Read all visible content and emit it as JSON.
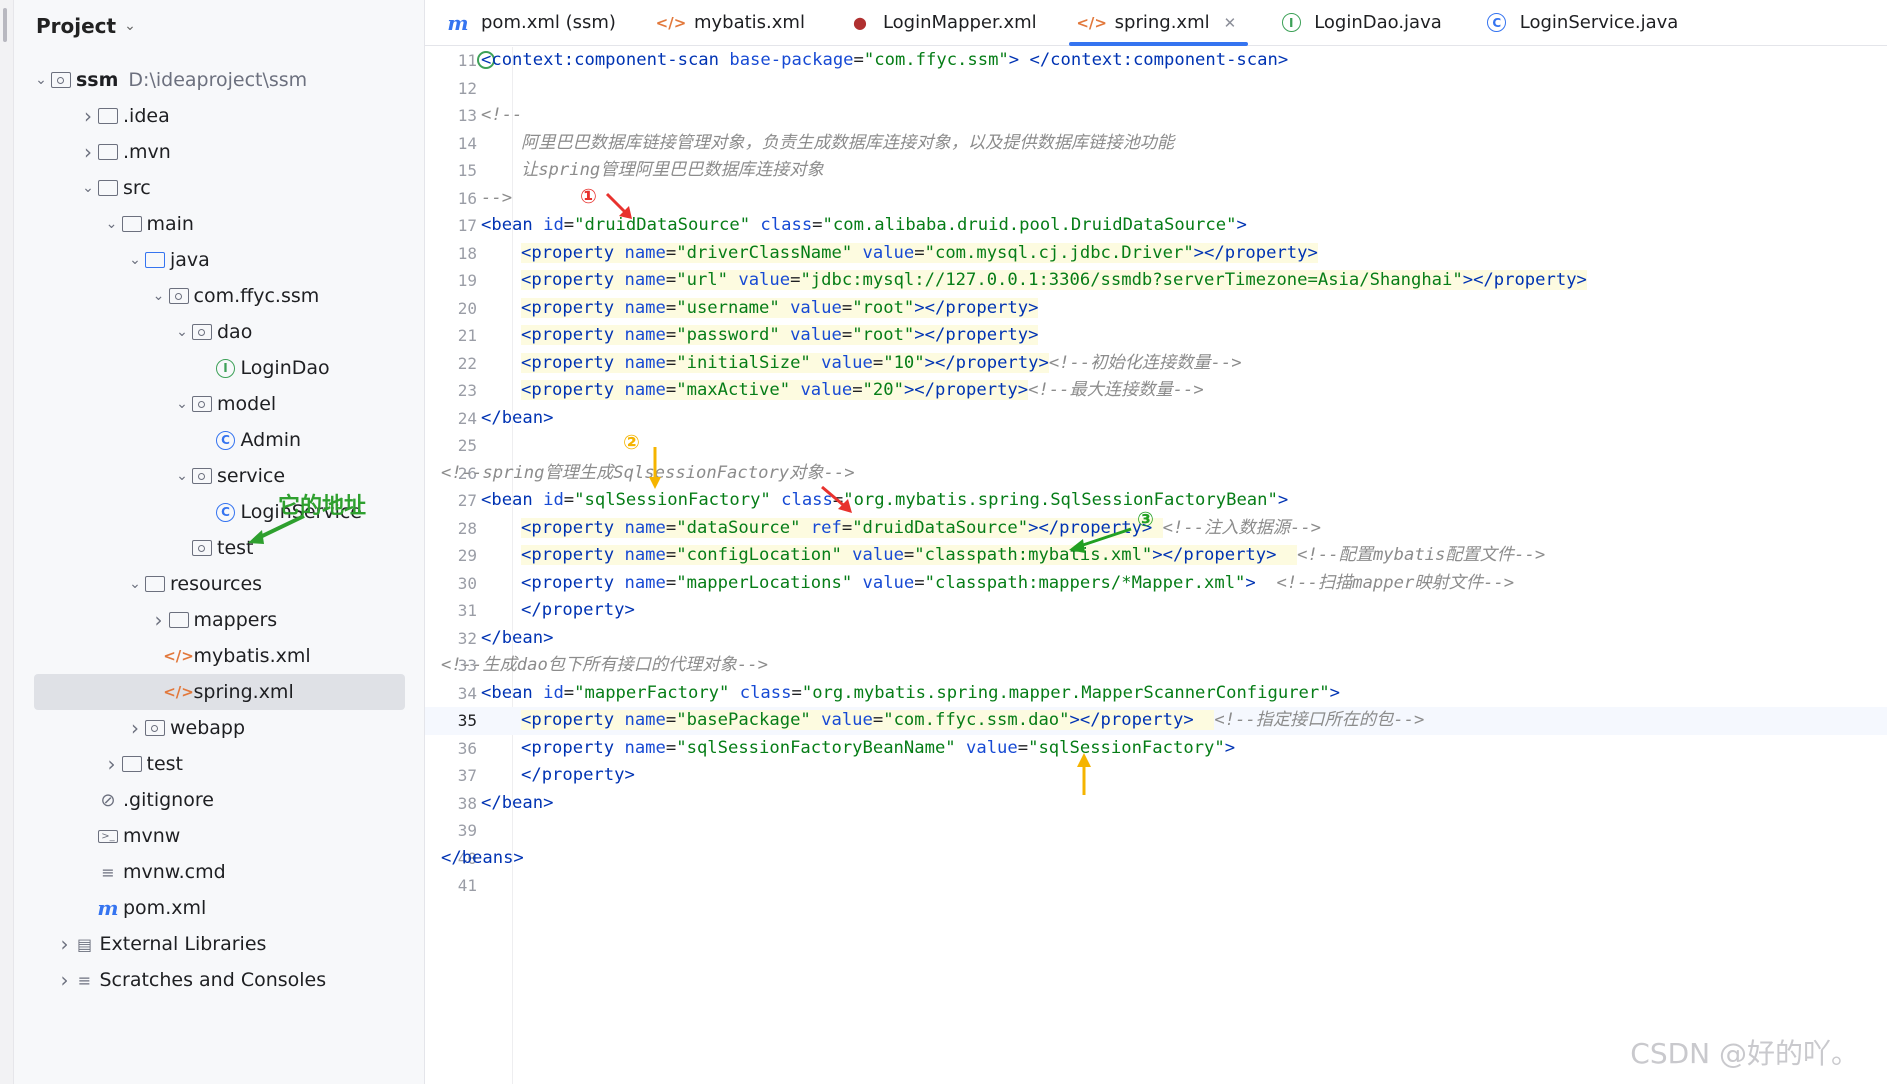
{
  "project": {
    "title": "Project",
    "root": {
      "name": "ssm",
      "path": "D:\\ideaproject\\ssm"
    },
    "tree": [
      {
        "label": ".idea",
        "level": 1,
        "icon": "folder-icon",
        "arrow": "right"
      },
      {
        "label": ".mvn",
        "level": 1,
        "icon": "folder-icon",
        "arrow": "right"
      },
      {
        "label": "src",
        "level": 1,
        "icon": "folder-icon",
        "arrow": "down"
      },
      {
        "label": "main",
        "level": 2,
        "icon": "folder-icon",
        "arrow": "down"
      },
      {
        "label": "java",
        "level": 3,
        "icon": "source-folder-icon",
        "arrow": "down"
      },
      {
        "label": "com.ffyc.ssm",
        "level": 4,
        "icon": "package-icon",
        "arrow": "down"
      },
      {
        "label": "dao",
        "level": 5,
        "icon": "package-icon",
        "arrow": "down"
      },
      {
        "label": "LoginDao",
        "level": 6,
        "icon": "interface-icon",
        "arrow": ""
      },
      {
        "label": "model",
        "level": 5,
        "icon": "package-icon",
        "arrow": "down"
      },
      {
        "label": "Admin",
        "level": 6,
        "icon": "class-icon",
        "arrow": ""
      },
      {
        "label": "service",
        "level": 5,
        "icon": "package-icon",
        "arrow": "down"
      },
      {
        "label": "LoginService",
        "level": 6,
        "icon": "class-icon",
        "arrow": ""
      },
      {
        "label": "test",
        "level": 5,
        "icon": "package-icon",
        "arrow": ""
      },
      {
        "label": "resources",
        "level": 3,
        "icon": "resources-folder-icon",
        "arrow": "down"
      },
      {
        "label": "mappers",
        "level": 4,
        "icon": "folder-icon",
        "arrow": "right"
      },
      {
        "label": "mybatis.xml",
        "level": 4,
        "icon": "xml-file-icon",
        "arrow": ""
      },
      {
        "label": "spring.xml",
        "level": 4,
        "icon": "spring-xml-icon",
        "arrow": "",
        "selected": true
      },
      {
        "label": "webapp",
        "level": 3,
        "icon": "web-folder-icon",
        "arrow": "right"
      },
      {
        "label": "test",
        "level": 2,
        "icon": "folder-icon",
        "arrow": "right"
      },
      {
        "label": ".gitignore",
        "level": 1,
        "icon": "ignore-file-icon",
        "arrow": ""
      },
      {
        "label": "mvnw",
        "level": 1,
        "icon": "shell-file-icon",
        "arrow": ""
      },
      {
        "label": "mvnw.cmd",
        "level": 1,
        "icon": "text-file-icon",
        "arrow": ""
      },
      {
        "label": "pom.xml",
        "level": 1,
        "icon": "maven-file-icon",
        "arrow": ""
      },
      {
        "label": "External Libraries",
        "level": 0,
        "icon": "library-icon",
        "arrow": "right"
      },
      {
        "label": "Scratches and Consoles",
        "level": 0,
        "icon": "scratches-icon",
        "arrow": "right"
      }
    ],
    "annotation": "它的地址"
  },
  "tabs": [
    {
      "label": "pom.xml (ssm)",
      "icon": "maven-file-icon"
    },
    {
      "label": "mybatis.xml",
      "icon": "xml-file-icon"
    },
    {
      "label": "LoginMapper.xml",
      "icon": "mybatis-file-icon"
    },
    {
      "label": "spring.xml",
      "icon": "spring-xml-icon",
      "active": true
    },
    {
      "label": "LoginDao.java",
      "icon": "interface-icon"
    },
    {
      "label": "LoginService.java",
      "icon": "class-icon"
    }
  ],
  "editor": {
    "current_line": 35,
    "lines": [
      {
        "n": 11,
        "indent": 1,
        "parts": [
          [
            "t",
            "<context:component-scan "
          ],
          [
            "a",
            "base-package"
          ],
          [
            "",
            "="
          ],
          [
            "v",
            "\"com.ffyc.ssm\""
          ],
          [
            "t",
            "> </context:component-scan>"
          ]
        ]
      },
      {
        "n": 12,
        "indent": 0,
        "parts": []
      },
      {
        "n": 13,
        "indent": 1,
        "parts": [
          [
            "c",
            "<!--"
          ]
        ]
      },
      {
        "n": 14,
        "indent": 2,
        "parts": [
          [
            "c",
            "阿里巴巴数据库链接管理对象，负责生成数据库连接对象，以及提供数据库链接池功能"
          ]
        ]
      },
      {
        "n": 15,
        "indent": 2,
        "parts": [
          [
            "c",
            "让spring管理阿里巴巴数据库连接对象"
          ]
        ]
      },
      {
        "n": 16,
        "indent": 1,
        "parts": [
          [
            "c",
            "-->"
          ]
        ]
      },
      {
        "n": 17,
        "indent": 1,
        "parts": [
          [
            "t",
            "<bean "
          ],
          [
            "a",
            "id"
          ],
          [
            "",
            "="
          ],
          [
            "v",
            "\"druidDataSource\" "
          ],
          [
            "a",
            "class"
          ],
          [
            "",
            "="
          ],
          [
            "v",
            "\"com.alibaba.druid.pool.DruidDataSource\""
          ],
          [
            "t",
            ">"
          ]
        ]
      },
      {
        "n": 18,
        "indent": 2,
        "parts": [
          [
            "t",
            "<property "
          ],
          [
            "a",
            "name"
          ],
          [
            "",
            "="
          ],
          [
            "v",
            "\"driverClassName\" "
          ],
          [
            "a",
            "value"
          ],
          [
            "",
            "="
          ],
          [
            "v",
            "\"com.mysql.cj.jdbc.Driver\""
          ],
          [
            "t",
            "></property>"
          ]
        ]
      },
      {
        "n": 19,
        "indent": 2,
        "parts": [
          [
            "t",
            "<property "
          ],
          [
            "a",
            "name"
          ],
          [
            "",
            "="
          ],
          [
            "v",
            "\"url\" "
          ],
          [
            "a",
            "value"
          ],
          [
            "",
            "="
          ],
          [
            "v",
            "\"jdbc:mysql://127.0.0.1:3306/ssmdb?serverTimezone=Asia/Shanghai\""
          ],
          [
            "t",
            "></property>"
          ]
        ]
      },
      {
        "n": 20,
        "indent": 2,
        "parts": [
          [
            "t",
            "<property "
          ],
          [
            "a",
            "name"
          ],
          [
            "",
            "="
          ],
          [
            "v",
            "\"username\" "
          ],
          [
            "a",
            "value"
          ],
          [
            "",
            "="
          ],
          [
            "v",
            "\"root\""
          ],
          [
            "t",
            "></property>"
          ]
        ]
      },
      {
        "n": 21,
        "indent": 2,
        "parts": [
          [
            "t",
            "<property "
          ],
          [
            "a",
            "name"
          ],
          [
            "",
            "="
          ],
          [
            "v",
            "\"password\" "
          ],
          [
            "a",
            "value"
          ],
          [
            "",
            "="
          ],
          [
            "v",
            "\"root\""
          ],
          [
            "t",
            "></property>"
          ]
        ]
      },
      {
        "n": 22,
        "indent": 2,
        "parts": [
          [
            "t",
            "<property "
          ],
          [
            "a",
            "name"
          ],
          [
            "",
            "="
          ],
          [
            "v",
            "\"initialSize\" "
          ],
          [
            "a",
            "value"
          ],
          [
            "",
            "="
          ],
          [
            "v",
            "\"10\""
          ],
          [
            "t",
            "></property>"
          ],
          [
            "c",
            "<!--初始化连接数量-->"
          ]
        ]
      },
      {
        "n": 23,
        "indent": 2,
        "parts": [
          [
            "t",
            "<property "
          ],
          [
            "a",
            "name"
          ],
          [
            "",
            "="
          ],
          [
            "v",
            "\"maxActive\" "
          ],
          [
            "a",
            "value"
          ],
          [
            "",
            "="
          ],
          [
            "v",
            "\"20\""
          ],
          [
            "t",
            "></property>"
          ],
          [
            "c",
            "<!--最大连接数量-->"
          ]
        ]
      },
      {
        "n": 24,
        "indent": 1,
        "parts": [
          [
            "t",
            "</bean>"
          ]
        ]
      },
      {
        "n": 25,
        "indent": 0,
        "parts": []
      },
      {
        "n": 26,
        "indent": 0,
        "parts": [
          [
            "c",
            "<!--spring管理生成SqlsessionFactory对象-->"
          ]
        ]
      },
      {
        "n": 27,
        "indent": 1,
        "parts": [
          [
            "t",
            "<bean "
          ],
          [
            "a",
            "id"
          ],
          [
            "",
            "="
          ],
          [
            "v",
            "\"sqlSessionFactory\" "
          ],
          [
            "a",
            "class"
          ],
          [
            "",
            "="
          ],
          [
            "v",
            "\"org.mybatis.spring.SqlSessionFactoryBean\""
          ],
          [
            "t",
            ">"
          ]
        ]
      },
      {
        "n": 28,
        "indent": 2,
        "parts": [
          [
            "t",
            "<property "
          ],
          [
            "a",
            "name"
          ],
          [
            "",
            "="
          ],
          [
            "v",
            "\"dataSource\" "
          ],
          [
            "a",
            "ref"
          ],
          [
            "",
            "="
          ],
          [
            "v",
            "\"druidDataSource\""
          ],
          [
            "t",
            "></property>"
          ],
          [
            "",
            " "
          ],
          [
            "c",
            "<!--注入数据源-->"
          ]
        ]
      },
      {
        "n": 29,
        "indent": 2,
        "parts": [
          [
            "t",
            "<property "
          ],
          [
            "a",
            "name"
          ],
          [
            "",
            "="
          ],
          [
            "v",
            "\"configLocation\" "
          ],
          [
            "a",
            "value"
          ],
          [
            "",
            "="
          ],
          [
            "v",
            "\"classpath:mybatis.xml\""
          ],
          [
            "t",
            "></property>"
          ],
          [
            "",
            "  "
          ],
          [
            "c",
            "<!--配置mybatis配置文件-->"
          ]
        ]
      },
      {
        "n": 30,
        "indent": 2,
        "parts": [
          [
            "t",
            "<property "
          ],
          [
            "a",
            "name"
          ],
          [
            "",
            "="
          ],
          [
            "v",
            "\"mapperLocations\" "
          ],
          [
            "a",
            "value"
          ],
          [
            "",
            "="
          ],
          [
            "v",
            "\"classpath:mappers/*Mapper.xml\""
          ],
          [
            "t",
            ">"
          ],
          [
            "",
            "  "
          ],
          [
            "c",
            "<!--扫描mapper映射文件-->"
          ]
        ]
      },
      {
        "n": 31,
        "indent": 2,
        "parts": [
          [
            "t",
            "</property>"
          ]
        ]
      },
      {
        "n": 32,
        "indent": 1,
        "parts": [
          [
            "t",
            "</bean>"
          ]
        ]
      },
      {
        "n": 33,
        "indent": 0,
        "parts": [
          [
            "c",
            "<!--生成dao包下所有接口的代理对象-->"
          ]
        ]
      },
      {
        "n": 34,
        "indent": 1,
        "parts": [
          [
            "t",
            "<bean "
          ],
          [
            "a",
            "id"
          ],
          [
            "",
            "="
          ],
          [
            "v",
            "\"mapperFactory\" "
          ],
          [
            "a",
            "class"
          ],
          [
            "",
            "="
          ],
          [
            "v",
            "\"org.mybatis.spring.mapper.MapperScannerConfigurer\""
          ],
          [
            "t",
            ">"
          ]
        ]
      },
      {
        "n": 35,
        "indent": 2,
        "parts": [
          [
            "t",
            "<property "
          ],
          [
            "a",
            "name"
          ],
          [
            "",
            "="
          ],
          [
            "v",
            "\"basePackage\" "
          ],
          [
            "a",
            "value"
          ],
          [
            "",
            "="
          ],
          [
            "v",
            "\"com.ffyc.ssm.dao\""
          ],
          [
            "t",
            "></property>"
          ],
          [
            "",
            "  "
          ],
          [
            "c",
            "<!--指定接口所在的包-->"
          ]
        ]
      },
      {
        "n": 36,
        "indent": 2,
        "parts": [
          [
            "t",
            "<property "
          ],
          [
            "a",
            "name"
          ],
          [
            "",
            "="
          ],
          [
            "v",
            "\"sqlSessionFactoryBeanName\" "
          ],
          [
            "a",
            "value"
          ],
          [
            "",
            "="
          ],
          [
            "v",
            "\"sqlSessionFactory\""
          ],
          [
            "t",
            ">"
          ]
        ]
      },
      {
        "n": 37,
        "indent": 2,
        "parts": [
          [
            "t",
            "</property>"
          ]
        ]
      },
      {
        "n": 38,
        "indent": 1,
        "parts": [
          [
            "t",
            "</bean>"
          ]
        ]
      },
      {
        "n": 39,
        "indent": 0,
        "parts": []
      },
      {
        "n": 40,
        "indent": 0,
        "parts": [
          [
            "t",
            "</beans>"
          ]
        ]
      },
      {
        "n": 41,
        "indent": 0,
        "parts": []
      }
    ],
    "highlight_lines": [
      18,
      19,
      20,
      21,
      22,
      23,
      28,
      29,
      35
    ],
    "markers": [
      "①",
      "②",
      "③"
    ]
  },
  "watermark": "CSDN @好的吖。",
  "colors": {
    "accent": "#3574f0",
    "tag": "#0033b3",
    "attr": "#174ad4",
    "value": "#067d17",
    "comment": "#8c8c8c"
  }
}
